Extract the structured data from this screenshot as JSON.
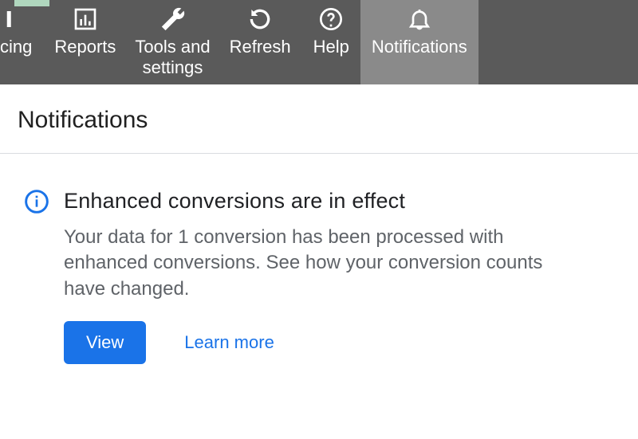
{
  "toolbar": {
    "items": [
      {
        "label": "cing"
      },
      {
        "label": "Reports"
      },
      {
        "label": "Tools and\nsettings"
      },
      {
        "label": "Refresh"
      },
      {
        "label": "Help"
      },
      {
        "label": "Notifications",
        "active": true
      }
    ]
  },
  "page": {
    "title": "Notifications"
  },
  "notification": {
    "title": "Enhanced conversions are in effect",
    "body": "Your data for 1 conversion has been processed with enhanced conversions. See how your conversion counts have changed.",
    "primary_label": "View",
    "secondary_label": "Learn more"
  },
  "colors": {
    "accent": "#1a73e8"
  }
}
